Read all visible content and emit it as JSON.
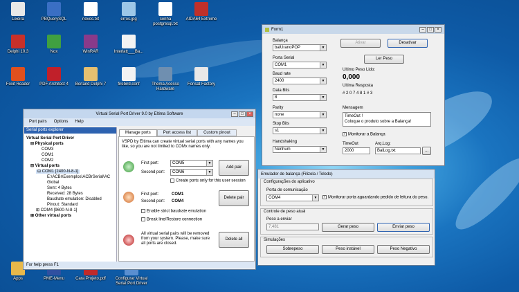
{
  "desktop": {
    "icons": [
      {
        "label": "Lixeira",
        "color": "#e8e8e8"
      },
      {
        "label": "PBQuerySQL",
        "color": "#3a6fc4"
      },
      {
        "label": "novos.txt",
        "color": "#ffffff"
      },
      {
        "label": "erros.jpg",
        "color": "#9cc7e8"
      },
      {
        "label": "senha postgresql.txt",
        "color": "#ffffff"
      },
      {
        "label": "AIDA64 Extreme",
        "color": "#c0302a"
      },
      {
        "label": "Delphi 10.3",
        "color": "#c8302a"
      },
      {
        "label": "Nox",
        "color": "#40a040"
      },
      {
        "label": "WinRAR",
        "color": "#8a3a8a"
      },
      {
        "label": "Interlatt___Ba...",
        "color": "#f3f3f3"
      },
      {
        "label": "Foxit Reader",
        "color": "#e0501e"
      },
      {
        "label": "PDF Architect 4",
        "color": "#c0202a"
      },
      {
        "label": "Borland Delphi 7",
        "color": "#e6c070"
      },
      {
        "label": "firebird.conf",
        "color": "#f3f3f3"
      },
      {
        "label": "Thema Acesso Hardware",
        "color": "#6f8fb0"
      },
      {
        "label": "Fonsat Factory",
        "color": "#e8e8e8"
      },
      {
        "label": "Apps",
        "color": "#e8b84a"
      },
      {
        "label": "PME-Menu",
        "color": "#3050a0"
      },
      {
        "label": "Cara Projeto.pdf",
        "color": "#c02a2a"
      },
      {
        "label": "Configurar Virtual Serial Port Driver",
        "color": "#5a8fd0"
      }
    ]
  },
  "vspd": {
    "title": "Virtual Serial Port Driver 9.0 by Eltima Software",
    "menu": [
      "Port pairs",
      "Options",
      "Help"
    ],
    "explorer_header": "Serial ports explorer",
    "tree": {
      "root": "Virtual Serial Port Driver",
      "physical": "Physical ports",
      "physical_items": [
        "COM3",
        "COM1",
        "COM2"
      ],
      "virtual": "Virtual ports",
      "com1": "COM1 [2400-N-8-1]",
      "path": "E:\\ACBr\\Exemplos\\ACBrSerial\\AC",
      "global": "Global",
      "sent": "Sent: 4 Bytes",
      "received": "Received: 28 Bytes",
      "baudrate": "Baudrate emulation: Disabled",
      "pinout": "Pinout: Standard",
      "com4": "COM4 [9600-N-8-1]",
      "other": "Other virtual ports"
    },
    "tabs": [
      "Manage ports",
      "Port access list",
      "Custom pinout"
    ],
    "description": "VSPD by Eltima can create virtual serial ports with any names you like, so you are not limited to COMx names only.",
    "add": {
      "first_label": "First port:",
      "first_value": "COM5",
      "second_label": "Second port:",
      "second_value": "COM6",
      "button": "Add pair",
      "checkbox": "Create ports only for this user session"
    },
    "delete": {
      "first_label": "First port:",
      "first_value": "COM1",
      "second_label": "Second port:",
      "second_value": "COM4",
      "button": "Delete pair",
      "check1": "Enable strict baudrate emulation",
      "check2": "Break line/Restore connection"
    },
    "delete_all": {
      "text": "All virtual serial pairs will be removed from your system. Please, make sure all ports are closed.",
      "button": "Delete all"
    },
    "status": "For help press F1"
  },
  "form1": {
    "title": "Form1",
    "balanca_label": "Balança",
    "balanca_value": "balUranoPOP",
    "porta_label": "Porta Serial",
    "porta_value": "COM1",
    "baud_label": "Baud rate",
    "baud_value": "2400",
    "databits_label": "Data Bits",
    "databits_value": "8",
    "parity_label": "Parity",
    "parity_value": "none",
    "stopbits_label": "Stop Bits",
    "stopbits_value": "s1",
    "handshaking_label": "Handshaking",
    "handshaking_value": "Nenhum",
    "ativar": "Ativar",
    "desativar": "Desativar",
    "ler_peso": "Ler Peso",
    "ultimo_peso_label": "Ultimo Peso Lido:",
    "ultimo_peso_value": "0,000",
    "ultima_resposta_label": "Ultima Resposta",
    "ultima_resposta_value": "# 2 0 7 4 8 1 # 3",
    "mensagem_label": "Mensagem",
    "mensagem_line1": "TimeOut !",
    "mensagem_line2": "Coloque o produto sobre a Balança!",
    "monitorar": "Monitorar a Balança",
    "timeout_label": "TimeOut",
    "timeout_value": "2000",
    "arqlog_label": "Arq.Log:",
    "arqlog_value": "BalLog.txt",
    "browse": "..."
  },
  "emulador": {
    "title": "Emulador de balança (Filizola / Toledo)",
    "config_header": "Configurações do aplicativo",
    "porta_label": "Porta de comunicação",
    "porta_value": "COM4",
    "monitorar": "Monitorar porta aguardando pedido de leitura do peso.",
    "controle_header": "Controle de peso atual",
    "peso_label": "Peso a enviar",
    "peso_value": "7,481",
    "gerar": "Gerar peso",
    "enviar": "Enviar peso",
    "sim_header": "Simulações",
    "sobrepeso": "Sobrepeso",
    "instavel": "Peso instável",
    "negativo": "Peso Negativo"
  },
  "colors": {
    "vspd_title": "#c4d7ee",
    "form_title": "#c8d8ea",
    "emulador_title": "#d6e3f2",
    "accent": "#2d62b0"
  }
}
